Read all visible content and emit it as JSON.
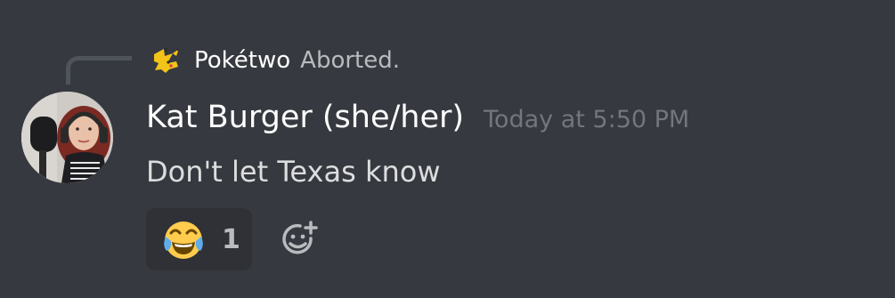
{
  "reply": {
    "author": "Pokétwo",
    "preview": "Aborted."
  },
  "message": {
    "username": "Kat Burger (she/her)",
    "timestamp": "Today at 5:50 PM",
    "content": "Don't let Texas know"
  },
  "reactions": [
    {
      "emoji": "face-with-tears-of-joy",
      "count": "1"
    }
  ],
  "icons": {
    "bot_avatar": "pikachu-icon",
    "add_reaction": "add-reaction-icon"
  },
  "colors": {
    "background": "#36393f",
    "username": "#ffffff",
    "timestamp": "#72767d",
    "content": "#dcddde",
    "reaction_bg": "#2f3136"
  }
}
